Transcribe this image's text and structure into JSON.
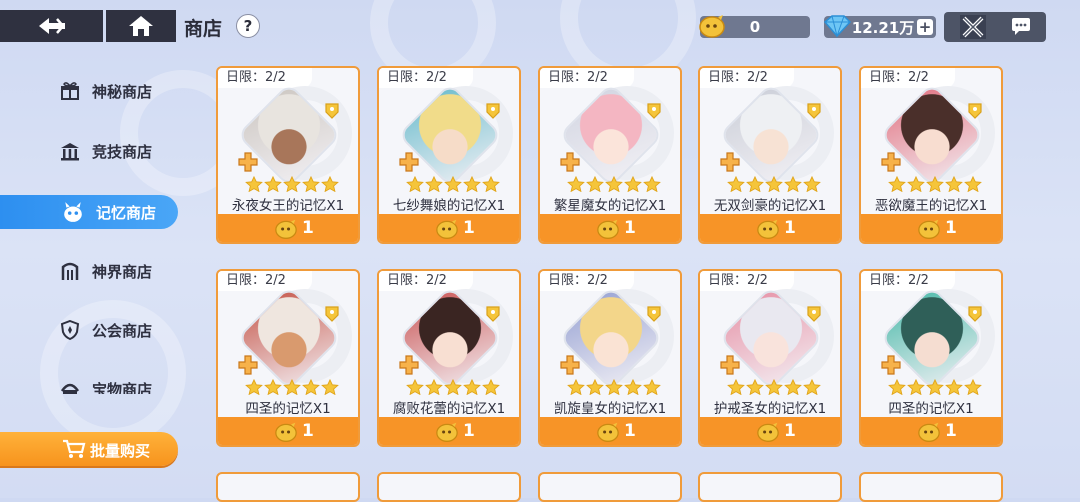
{
  "header": {
    "title": "商店",
    "help_label": "?",
    "coin_amount": "0",
    "gem_amount": "12.21万",
    "gem_add_label": "+"
  },
  "sidebar": {
    "items": [
      {
        "label": "神秘商店",
        "icon": "gift-icon",
        "active": false
      },
      {
        "label": "竞技商店",
        "icon": "arena-building-icon",
        "active": false
      },
      {
        "label": "记忆商店",
        "icon": "memory-creature-icon",
        "active": true
      },
      {
        "label": "神界商店",
        "icon": "gate-icon",
        "active": false
      },
      {
        "label": "公会商店",
        "icon": "guild-shield-icon",
        "active": false
      },
      {
        "label": "宝物商店",
        "icon": "treasure-icon",
        "active": false
      }
    ],
    "bulk_buy_label": "批量购买"
  },
  "cards": [
    {
      "limit": "日限：2/2",
      "name": "永夜女王的记忆X1",
      "price": "1",
      "hair": "#e8e4df",
      "skin": "#a8765a",
      "accent": "#c9c3bd"
    },
    {
      "limit": "日限：2/2",
      "name": "七纱舞娘的记忆X1",
      "price": "1",
      "hair": "#f1dc8a",
      "skin": "#f6dcc8",
      "accent": "#5fb7c9"
    },
    {
      "limit": "日限：2/2",
      "name": "繁星魔女的记忆X1",
      "price": "1",
      "hair": "#f4b6c2",
      "skin": "#fbe4da",
      "accent": "#cfd3e0"
    },
    {
      "limit": "日限：2/2",
      "name": "无双剑豪的记忆X1",
      "price": "1",
      "hair": "#eef0f3",
      "skin": "#f7e2d4",
      "accent": "#c8ccd6"
    },
    {
      "limit": "日限：2/2",
      "name": "恶欲魔王的记忆X1",
      "price": "1",
      "hair": "#4a2f2a",
      "skin": "#f8ddd0",
      "accent": "#e06a7a"
    },
    {
      "limit": "日限：2/2",
      "name": "四圣的记忆X1",
      "price": "1",
      "hair": "#efe6df",
      "skin": "#d99a6e",
      "accent": "#c24b3e"
    },
    {
      "limit": "日限：2/2",
      "name": "腐败花蕾的记忆X1",
      "price": "1",
      "hair": "#3a2522",
      "skin": "#f8dfd2",
      "accent": "#c74b4b"
    },
    {
      "limit": "日限：2/2",
      "name": "凯旋皇女的记忆X1",
      "price": "1",
      "hair": "#f3d68a",
      "skin": "#fae3d4",
      "accent": "#8f9bd0"
    },
    {
      "limit": "日限：2/2",
      "name": "护戒圣女的记忆X1",
      "price": "1",
      "hair": "#e9e8f0",
      "skin": "#f9e3dc",
      "accent": "#e58aa0"
    },
    {
      "limit": "日限：2/2",
      "name": "四圣的记忆X1",
      "price": "1",
      "hair": "#2f5f58",
      "skin": "#f5ddd1",
      "accent": "#3fb5a4"
    }
  ],
  "icons": {
    "back": "back-arrow-icon",
    "home": "home-icon",
    "coin": "memory-coin-icon",
    "gem": "gem-icon",
    "tools": "crossed-tools-icon",
    "chat": "chat-bubble-icon",
    "cart": "cart-icon"
  }
}
